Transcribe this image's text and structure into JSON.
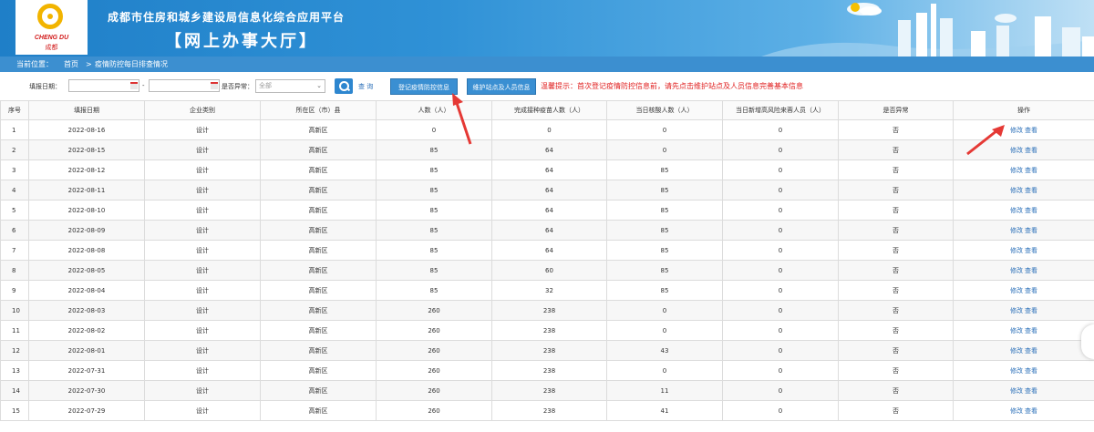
{
  "header": {
    "logo_en": "CHENG DU",
    "logo_cn": "成都",
    "title": "成都市住房和城乡建设局信息化综合应用平台",
    "subtitle": "【网上办事大厅】"
  },
  "breadcrumb": {
    "prefix": "当前位置：",
    "home": "首页",
    "separator": ">",
    "current": "疫情防控每日排查情况"
  },
  "toolbar": {
    "date_label": "填报日期：",
    "date_sep": "-",
    "abnormal_label": "是否异常：",
    "abnormal_value": "全部",
    "query_label": "查 询",
    "register_btn": "登记疫情防控信息",
    "maintain_btn": "维护站点及人员信息",
    "notice": "温馨提示：首次登记疫情防控信息前，请先点击维护站点及人员信息完善基本信息"
  },
  "table": {
    "headers": [
      "序号",
      "填报日期",
      "企业类别",
      "所在区（市）县",
      "人数（人）",
      "完成接种疫苗人数（人）",
      "当日核酸人数（人）",
      "当日新增高风险来蓉人员（人）",
      "是否异常",
      "操作"
    ],
    "ops": {
      "edit": "修改",
      "view": "查看"
    },
    "rows": [
      [
        "1",
        "2022-08-16",
        "设计",
        "高新区",
        "0",
        "0",
        "0",
        "0",
        "否"
      ],
      [
        "2",
        "2022-08-15",
        "设计",
        "高新区",
        "85",
        "64",
        "0",
        "0",
        "否"
      ],
      [
        "3",
        "2022-08-12",
        "设计",
        "高新区",
        "85",
        "64",
        "85",
        "0",
        "否"
      ],
      [
        "4",
        "2022-08-11",
        "设计",
        "高新区",
        "85",
        "64",
        "85",
        "0",
        "否"
      ],
      [
        "5",
        "2022-08-10",
        "设计",
        "高新区",
        "85",
        "64",
        "85",
        "0",
        "否"
      ],
      [
        "6",
        "2022-08-09",
        "设计",
        "高新区",
        "85",
        "64",
        "85",
        "0",
        "否"
      ],
      [
        "7",
        "2022-08-08",
        "设计",
        "高新区",
        "85",
        "64",
        "85",
        "0",
        "否"
      ],
      [
        "8",
        "2022-08-05",
        "设计",
        "高新区",
        "85",
        "60",
        "85",
        "0",
        "否"
      ],
      [
        "9",
        "2022-08-04",
        "设计",
        "高新区",
        "85",
        "32",
        "85",
        "0",
        "否"
      ],
      [
        "10",
        "2022-08-03",
        "设计",
        "高新区",
        "260",
        "238",
        "0",
        "0",
        "否"
      ],
      [
        "11",
        "2022-08-02",
        "设计",
        "高新区",
        "260",
        "238",
        "0",
        "0",
        "否"
      ],
      [
        "12",
        "2022-08-01",
        "设计",
        "高新区",
        "260",
        "238",
        "43",
        "0",
        "否"
      ],
      [
        "13",
        "2022-07-31",
        "设计",
        "高新区",
        "260",
        "238",
        "0",
        "0",
        "否"
      ],
      [
        "14",
        "2022-07-30",
        "设计",
        "高新区",
        "260",
        "238",
        "11",
        "0",
        "否"
      ],
      [
        "15",
        "2022-07-29",
        "设计",
        "高新区",
        "260",
        "238",
        "41",
        "0",
        "否"
      ]
    ]
  },
  "colors": {
    "header_blue": "#1f7fc8",
    "breadcrumb_blue": "#3c8fd0",
    "notice_red": "#e02020",
    "arrow_red": "#e53935",
    "link_blue": "#2a6fb8"
  }
}
